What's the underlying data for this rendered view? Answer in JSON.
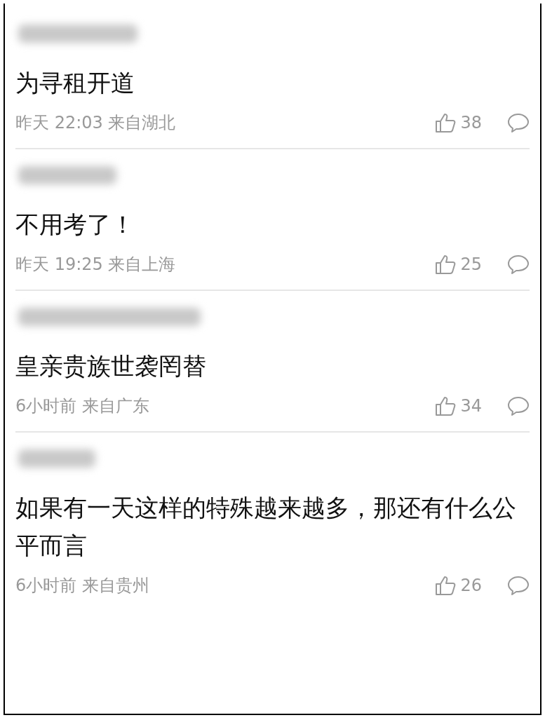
{
  "comments": [
    {
      "text": "为寻租开道",
      "time": "昨天 22:03",
      "location": "来自湖北",
      "likes": "38"
    },
    {
      "text": "不用考了！",
      "time": "昨天 19:25",
      "location": "来自上海",
      "likes": "25"
    },
    {
      "text": "皇亲贵族世袭罔替",
      "time": "6小时前",
      "location": "来自广东",
      "likes": "34"
    },
    {
      "text": "如果有一天这样的特殊越来越多，那还有什么公平而言",
      "time": "6小时前",
      "location": "来自贵州",
      "likes": "26"
    }
  ]
}
